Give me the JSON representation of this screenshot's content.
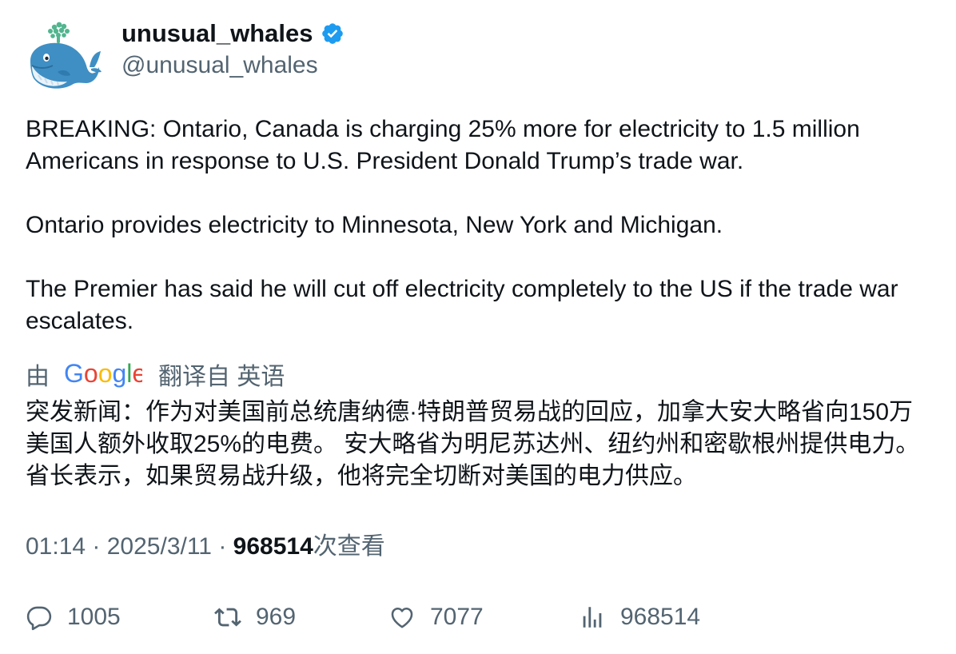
{
  "author": {
    "display_name": "unusual_whales",
    "handle": "@unusual_whales",
    "verified": true,
    "verified_color": "#1d9bf0",
    "avatar_icon": "whale-icon"
  },
  "tweet": {
    "paragraphs": [
      "BREAKING: Ontario, Canada is charging 25% more for electricity to 1.5 million Americans in response to U.S. President Donald Trump’s trade war.",
      "Ontario provides electricity to Minnesota, New York and Michigan.",
      "The Premier has said he will cut off electricity completely to the US if the trade war escalates."
    ]
  },
  "translation": {
    "prefix": "由",
    "provider": "Google",
    "suffix": "翻译自 英语",
    "text": "突发新闻：作为对美国前总统唐纳德·特朗普贸易战的回应，加拿大安大略省向150万美国人额外收取25%的电费。 安大略省为明尼苏达州、纽约州和密歇根州提供电力。 省长表示，如果贸易战升级，他将完全切断对美国的电力供应。"
  },
  "meta": {
    "time": "01:14",
    "separator": " · ",
    "date": "2025/3/11",
    "views_count": "968514",
    "views_label": "次查看"
  },
  "actions": {
    "replies": "1005",
    "retweets": "969",
    "likes": "7077",
    "views": "968514"
  },
  "colors": {
    "text_primary": "#0f1419",
    "text_secondary": "#536471",
    "accent": "#1d9bf0"
  }
}
